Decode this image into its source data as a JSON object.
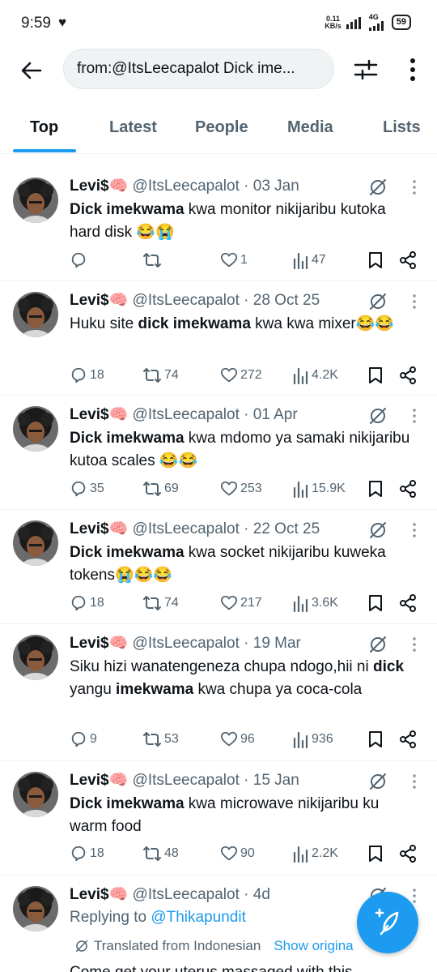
{
  "status_bar": {
    "time": "9:59",
    "speed_value": "0.11",
    "speed_unit": "KB/s",
    "network": "4G",
    "battery": "59"
  },
  "search": {
    "query": "from:@ItsLeecapalot Dick ime..."
  },
  "tabs": [
    {
      "label": "Top",
      "active": true
    },
    {
      "label": "Latest"
    },
    {
      "label": "People"
    },
    {
      "label": "Media"
    },
    {
      "label": "Lists"
    }
  ],
  "colors": {
    "accent": "#1d9bf0",
    "text_primary": "#0f1419",
    "text_secondary": "#536471"
  },
  "tweets": [
    {
      "name": "Levi$🧠",
      "handle": "@ItsLeecapalot",
      "date": "· 03 Jan",
      "text_parts": [
        {
          "t": "Dick imekwama",
          "b": true
        },
        {
          "t": " kwa monitor nikijaribu kutoka hard disk 😂😭",
          "b": false
        }
      ],
      "replies": "",
      "reposts": "",
      "likes": "1",
      "views": "47"
    },
    {
      "name": "Levi$🧠",
      "handle": "@ItsLeecapalot",
      "date": "· 28 Oct 25",
      "text_parts": [
        {
          "t": "Huku site ",
          "b": false
        },
        {
          "t": "dick imekwama",
          "b": true
        },
        {
          "t": " kwa  kwa mixer😂😂",
          "b": false
        }
      ],
      "replies": "18",
      "reposts": "74",
      "likes": "272",
      "views": "4.2K"
    },
    {
      "name": "Levi$🧠",
      "handle": "@ItsLeecapalot",
      "date": "· 01 Apr",
      "text_parts": [
        {
          "t": "Dick imekwama",
          "b": true
        },
        {
          "t": " kwa mdomo ya samaki nikijaribu kutoa scales 😂😂",
          "b": false
        }
      ],
      "replies": "35",
      "reposts": "69",
      "likes": "253",
      "views": "15.9K"
    },
    {
      "name": "Levi$🧠",
      "handle": "@ItsLeecapalot",
      "date": "· 22 Oct 25",
      "text_parts": [
        {
          "t": "Dick imekwama",
          "b": true
        },
        {
          "t": " kwa socket nikijaribu kuweka tokens😭😂😂",
          "b": false
        }
      ],
      "replies": "18",
      "reposts": "74",
      "likes": "217",
      "views": "3.6K"
    },
    {
      "name": "Levi$🧠",
      "handle": "@ItsLeecapalot",
      "date": "· 19 Mar",
      "text_parts": [
        {
          "t": "Siku hizi wanatengeneza chupa ndogo,hii ni ",
          "b": false
        },
        {
          "t": "dick",
          "b": true
        },
        {
          "t": " yangu ",
          "b": false
        },
        {
          "t": "imekwama",
          "b": true
        },
        {
          "t": " kwa chupa ya coca-cola",
          "b": false
        }
      ],
      "replies": "9",
      "reposts": "53",
      "likes": "96",
      "views": "936"
    },
    {
      "name": "Levi$🧠",
      "handle": "@ItsLeecapalot",
      "date": "· 15 Jan",
      "text_parts": [
        {
          "t": "Dick imekwama",
          "b": true
        },
        {
          "t": " kwa microwave nikijaribu ku warm food",
          "b": false
        }
      ],
      "replies": "18",
      "reposts": "48",
      "likes": "90",
      "views": "2.2K"
    },
    {
      "name": "Levi$🧠",
      "handle": "@ItsLeecapalot",
      "date": "· 4d",
      "replying_prefix": "Replying to ",
      "replying_to": "@Thikapundit",
      "translated_label": "Translated from Indonesian",
      "show_original": "Show origina",
      "text_partial": "Come get your uterus massaged with this"
    }
  ]
}
